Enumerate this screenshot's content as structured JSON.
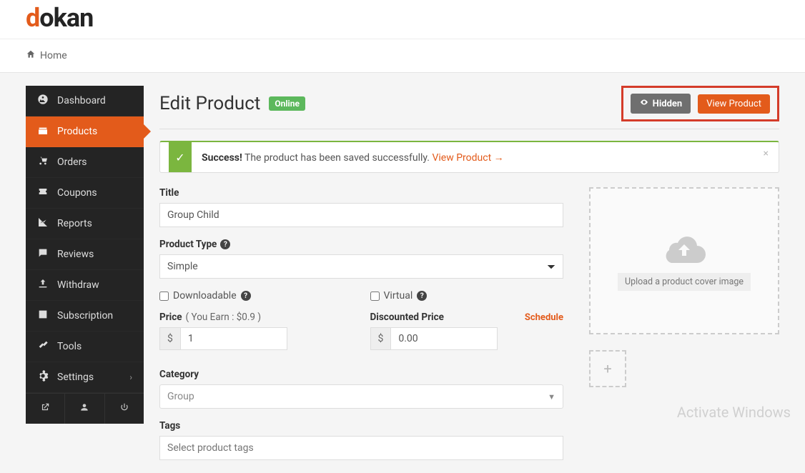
{
  "brand": {
    "d": "d",
    "okan": "okan"
  },
  "breadcrumb": {
    "home": "Home"
  },
  "sidebar": {
    "items": [
      {
        "label": "Dashboard"
      },
      {
        "label": "Products"
      },
      {
        "label": "Orders"
      },
      {
        "label": "Coupons"
      },
      {
        "label": "Reports"
      },
      {
        "label": "Reviews"
      },
      {
        "label": "Withdraw"
      },
      {
        "label": "Subscription"
      },
      {
        "label": "Tools"
      },
      {
        "label": "Settings"
      }
    ]
  },
  "page": {
    "title": "Edit Product",
    "online_badge": "Online",
    "hidden_btn": "Hidden",
    "view_btn": "View Product"
  },
  "alert": {
    "strong": "Success!",
    "text": " The product has been saved successfully. ",
    "link": "View Product →"
  },
  "form": {
    "title_label": "Title",
    "title_value": "Group Child",
    "type_label": "Product Type",
    "type_value": "Simple",
    "downloadable": "Downloadable",
    "virtual": "Virtual",
    "price_label": "Price",
    "earn_text": " ( You Earn : $0.9 )",
    "price_value": "1",
    "disc_label": "Discounted Price",
    "disc_value": "0.00",
    "schedule": "Schedule",
    "currency": "$",
    "category_label": "Category",
    "category_value": "Group",
    "tags_label": "Tags",
    "tags_placeholder": "Select product tags",
    "cover_text": "Upload a product cover image",
    "add_img": "+"
  },
  "watermark": "Activate Windows"
}
